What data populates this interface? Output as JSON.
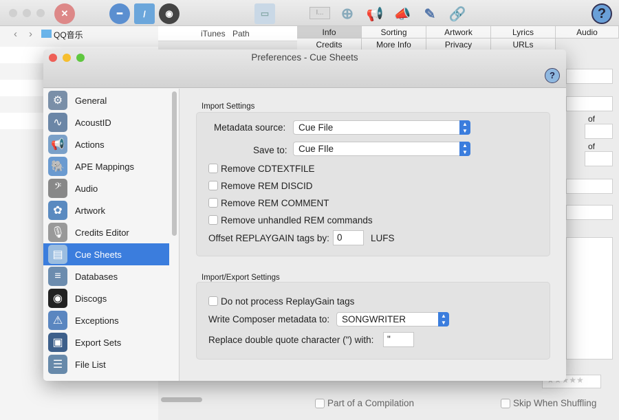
{
  "toolbar": {
    "icons": [
      "close-x-icon",
      "remove-icon",
      "folder-icon",
      "disc-icon",
      "save-icon",
      "text-field-icon",
      "zoom-icon",
      "announce-icon",
      "announce-edit-icon",
      "pencil-icon",
      "link-icon",
      "help-icon"
    ],
    "text_field": "I..."
  },
  "nav": {
    "folder": "QQ音乐"
  },
  "columns": [
    "iTunes",
    "Path"
  ],
  "tabs": {
    "row1": [
      "Info",
      "Sorting",
      "Artwork",
      "Lyrics",
      "Audio"
    ],
    "row2": [
      "Credits",
      "More Info",
      "Privacy",
      "URLs"
    ],
    "selected": "Info"
  },
  "background": {
    "of1": "of",
    "of2": "of",
    "compilation": "Part of a Compilation",
    "shuffling": "Skip When Shuffling"
  },
  "dialog": {
    "title": "Preferences - Cue Sheets",
    "sidebar": [
      "General",
      "AcoustID",
      "Actions",
      "APE Mappings",
      "Audio",
      "Artwork",
      "Credits Editor",
      "Cue Sheets",
      "Databases",
      "Discogs",
      "Exceptions",
      "Export Sets",
      "File List"
    ],
    "selected": "Cue Sheets",
    "import": {
      "title": "Import Settings",
      "metadata_label": "Metadata source:",
      "metadata_value": "Cue File",
      "save_label": "Save to:",
      "save_value": "Cue FIle",
      "checks": [
        "Remove CDTEXTFILE",
        "Remove REM DISCID",
        "Remove REM COMMENT",
        "Remove unhandled REM commands"
      ],
      "offset_label": "Offset REPLAYGAIN tags by:",
      "offset_value": "0",
      "offset_unit": "LUFS"
    },
    "export": {
      "title": "Import/Export Settings",
      "check": "Do not process ReplayGain tags",
      "composer_label": "Write Composer metadata to:",
      "composer_value": "SONGWRITER",
      "quote_label": "Replace double quote character (\") with:",
      "quote_value": "\""
    }
  }
}
